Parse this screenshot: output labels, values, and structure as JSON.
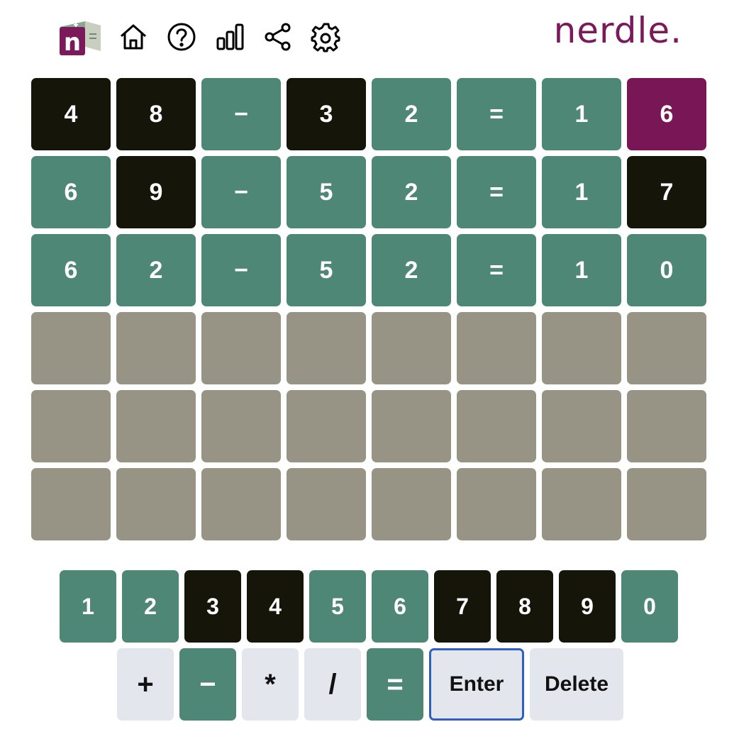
{
  "brand": "nerdle.",
  "header": {
    "logo_letter": "n",
    "icons": [
      "home-icon",
      "help-icon",
      "stats-icon",
      "share-icon",
      "settings-icon"
    ]
  },
  "colors": {
    "green": "#4f8776",
    "black": "#15150a",
    "purple": "#781656",
    "empty": "#979385",
    "key_light": "#e3e6ed",
    "brand": "#7a1a5a",
    "enter_border": "#2f5fc4"
  },
  "board": {
    "rows": [
      {
        "tiles": [
          {
            "char": "4",
            "state": "black"
          },
          {
            "char": "8",
            "state": "black"
          },
          {
            "char": "−",
            "state": "green"
          },
          {
            "char": "3",
            "state": "black"
          },
          {
            "char": "2",
            "state": "green"
          },
          {
            "char": "=",
            "state": "green"
          },
          {
            "char": "1",
            "state": "green"
          },
          {
            "char": "6",
            "state": "purple"
          }
        ]
      },
      {
        "tiles": [
          {
            "char": "6",
            "state": "green"
          },
          {
            "char": "9",
            "state": "black"
          },
          {
            "char": "−",
            "state": "green"
          },
          {
            "char": "5",
            "state": "green"
          },
          {
            "char": "2",
            "state": "green"
          },
          {
            "char": "=",
            "state": "green"
          },
          {
            "char": "1",
            "state": "green"
          },
          {
            "char": "7",
            "state": "black"
          }
        ]
      },
      {
        "tiles": [
          {
            "char": "6",
            "state": "green"
          },
          {
            "char": "2",
            "state": "green"
          },
          {
            "char": "−",
            "state": "green"
          },
          {
            "char": "5",
            "state": "green"
          },
          {
            "char": "2",
            "state": "green"
          },
          {
            "char": "=",
            "state": "green"
          },
          {
            "char": "1",
            "state": "green"
          },
          {
            "char": "0",
            "state": "green"
          }
        ]
      },
      {
        "tiles": [
          {
            "char": "",
            "state": "empty"
          },
          {
            "char": "",
            "state": "empty"
          },
          {
            "char": "",
            "state": "empty"
          },
          {
            "char": "",
            "state": "empty"
          },
          {
            "char": "",
            "state": "empty"
          },
          {
            "char": "",
            "state": "empty"
          },
          {
            "char": "",
            "state": "empty"
          },
          {
            "char": "",
            "state": "empty"
          }
        ]
      },
      {
        "tiles": [
          {
            "char": "",
            "state": "empty"
          },
          {
            "char": "",
            "state": "empty"
          },
          {
            "char": "",
            "state": "empty"
          },
          {
            "char": "",
            "state": "empty"
          },
          {
            "char": "",
            "state": "empty"
          },
          {
            "char": "",
            "state": "empty"
          },
          {
            "char": "",
            "state": "empty"
          },
          {
            "char": "",
            "state": "empty"
          }
        ]
      },
      {
        "tiles": [
          {
            "char": "",
            "state": "empty"
          },
          {
            "char": "",
            "state": "empty"
          },
          {
            "char": "",
            "state": "empty"
          },
          {
            "char": "",
            "state": "empty"
          },
          {
            "char": "",
            "state": "empty"
          },
          {
            "char": "",
            "state": "empty"
          },
          {
            "char": "",
            "state": "empty"
          },
          {
            "char": "",
            "state": "empty"
          }
        ]
      }
    ]
  },
  "keyboard": {
    "row1": [
      {
        "label": "1",
        "state": "green"
      },
      {
        "label": "2",
        "state": "green"
      },
      {
        "label": "3",
        "state": "black"
      },
      {
        "label": "4",
        "state": "black"
      },
      {
        "label": "5",
        "state": "green"
      },
      {
        "label": "6",
        "state": "green"
      },
      {
        "label": "7",
        "state": "black"
      },
      {
        "label": "8",
        "state": "black"
      },
      {
        "label": "9",
        "state": "black"
      },
      {
        "label": "0",
        "state": "green"
      }
    ],
    "row2": [
      {
        "label": "+",
        "state": "light",
        "kind": "op",
        "name": "key-plus"
      },
      {
        "label": "−",
        "state": "green",
        "kind": "op",
        "name": "key-minus"
      },
      {
        "label": "*",
        "state": "light",
        "kind": "op",
        "name": "key-multiply"
      },
      {
        "label": "/",
        "state": "light",
        "kind": "op",
        "name": "key-divide"
      },
      {
        "label": "=",
        "state": "green",
        "kind": "op",
        "name": "key-equals"
      },
      {
        "label": "Enter",
        "state": "light",
        "kind": "enter",
        "name": "enter-button"
      },
      {
        "label": "Delete",
        "state": "light",
        "kind": "delete",
        "name": "delete-button"
      }
    ]
  }
}
